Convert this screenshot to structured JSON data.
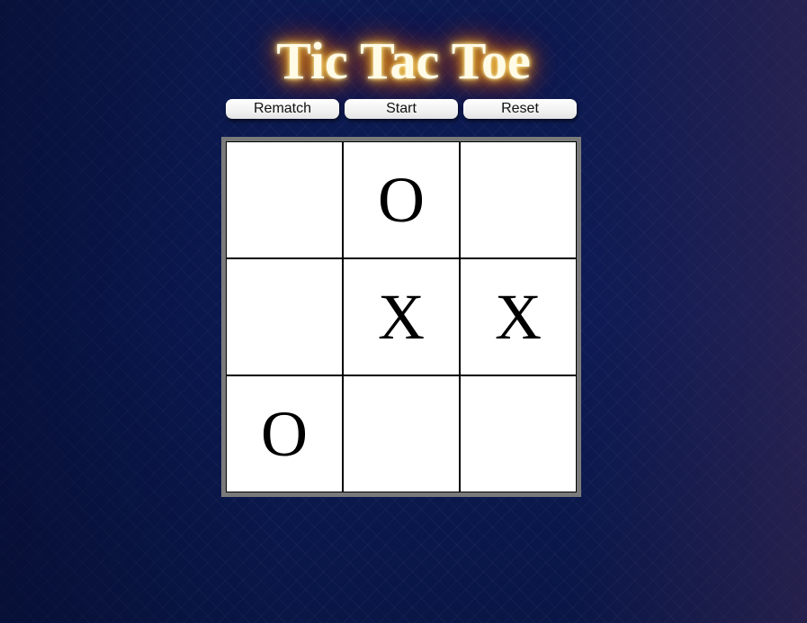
{
  "title": "Tic Tac Toe",
  "controls": {
    "rematch_label": "Rematch",
    "start_label": "Start",
    "reset_label": "Reset"
  },
  "board": {
    "cells": [
      "",
      "O",
      "",
      "",
      "X",
      "X",
      "O",
      "",
      ""
    ]
  },
  "colors": {
    "title_glow": "#ffae00",
    "board_border": "#7a7a7a",
    "cell_background": "#ffffff",
    "page_background": "#0b1a4e"
  }
}
